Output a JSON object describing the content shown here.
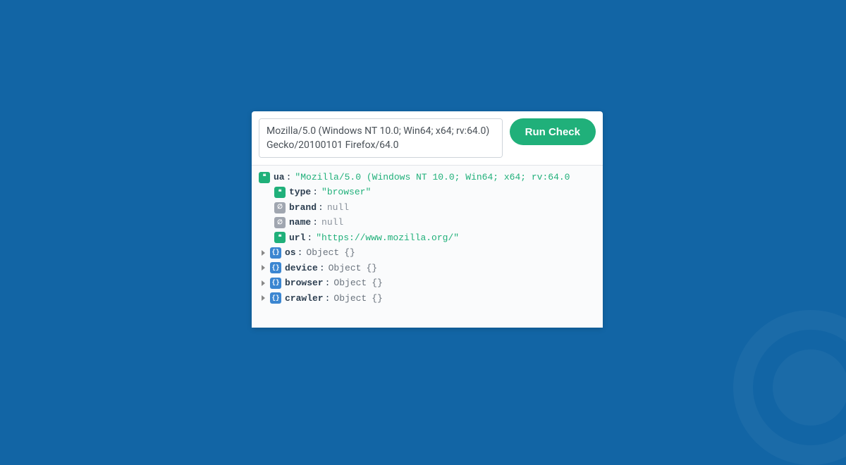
{
  "input": {
    "ua_value": "Mozilla/5.0 (Windows NT 10.0; Win64; x64; rv:64.0) Gecko/20100101 Firefox/64.0",
    "run_label": "Run Check"
  },
  "badges": {
    "string": "❝",
    "null": "∅",
    "object": "{}"
  },
  "result": {
    "ua": {
      "key": "ua",
      "value": "\"Mozilla/5.0 (Windows NT 10.0; Win64; x64; rv:64.0"
    },
    "type": {
      "key": "type",
      "value": "\"browser\""
    },
    "brand": {
      "key": "brand",
      "value": "null"
    },
    "name": {
      "key": "name",
      "value": "null"
    },
    "url": {
      "key": "url",
      "value": "\"https://www.mozilla.org/\""
    },
    "os": {
      "key": "os",
      "type": "Object",
      "braces": "{}"
    },
    "device": {
      "key": "device",
      "type": "Object",
      "braces": "{}"
    },
    "browser": {
      "key": "browser",
      "type": "Object",
      "braces": "{}"
    },
    "crawler": {
      "key": "crawler",
      "type": "Object",
      "braces": "{}"
    }
  }
}
